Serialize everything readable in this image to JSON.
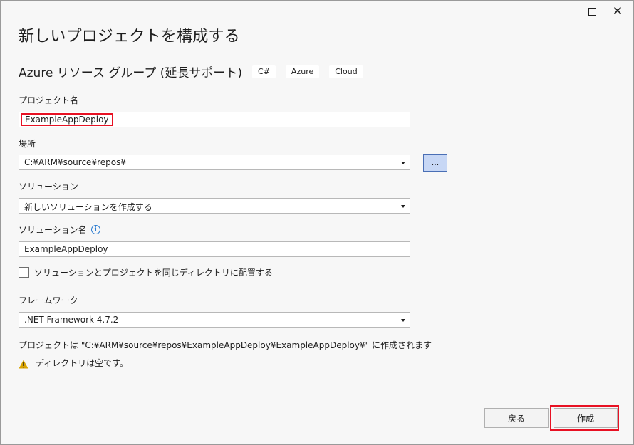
{
  "window": {
    "close_glyph": "✕",
    "maximize_icon": "maximize-icon",
    "close_icon": "close-icon"
  },
  "page": {
    "title": "新しいプロジェクトを構成する"
  },
  "template": {
    "name": "Azure リソース グループ (延長サポート)",
    "tags": [
      "C#",
      "Azure",
      "Cloud"
    ]
  },
  "project_name": {
    "label": "プロジェクト名",
    "value": "ExampleAppDeploy"
  },
  "location": {
    "label": "場所",
    "value": "C:¥ARM¥source¥repos¥",
    "browse_label": "..."
  },
  "solution": {
    "label": "ソリューション",
    "value": "新しいソリューションを作成する"
  },
  "solution_name": {
    "label": "ソリューション名",
    "info_glyph": "i",
    "value": "ExampleAppDeploy"
  },
  "same_dir": {
    "label": "ソリューションとプロジェクトを同じディレクトリに配置する",
    "checked": false
  },
  "framework": {
    "label": "フレームワーク",
    "value": ".NET Framework 4.7.2"
  },
  "notes": {
    "path": "プロジェクトは \"C:¥ARM¥source¥repos¥ExampleAppDeploy¥ExampleAppDeploy¥\" に作成されます",
    "warning": "ディレクトリは空です。"
  },
  "buttons": {
    "back": "戻る",
    "create": "作成"
  },
  "colors": {
    "highlight": "#e81123",
    "warning": "#d9a300",
    "info": "#2a7bd1",
    "browse_bg": "#c7d7f5"
  }
}
